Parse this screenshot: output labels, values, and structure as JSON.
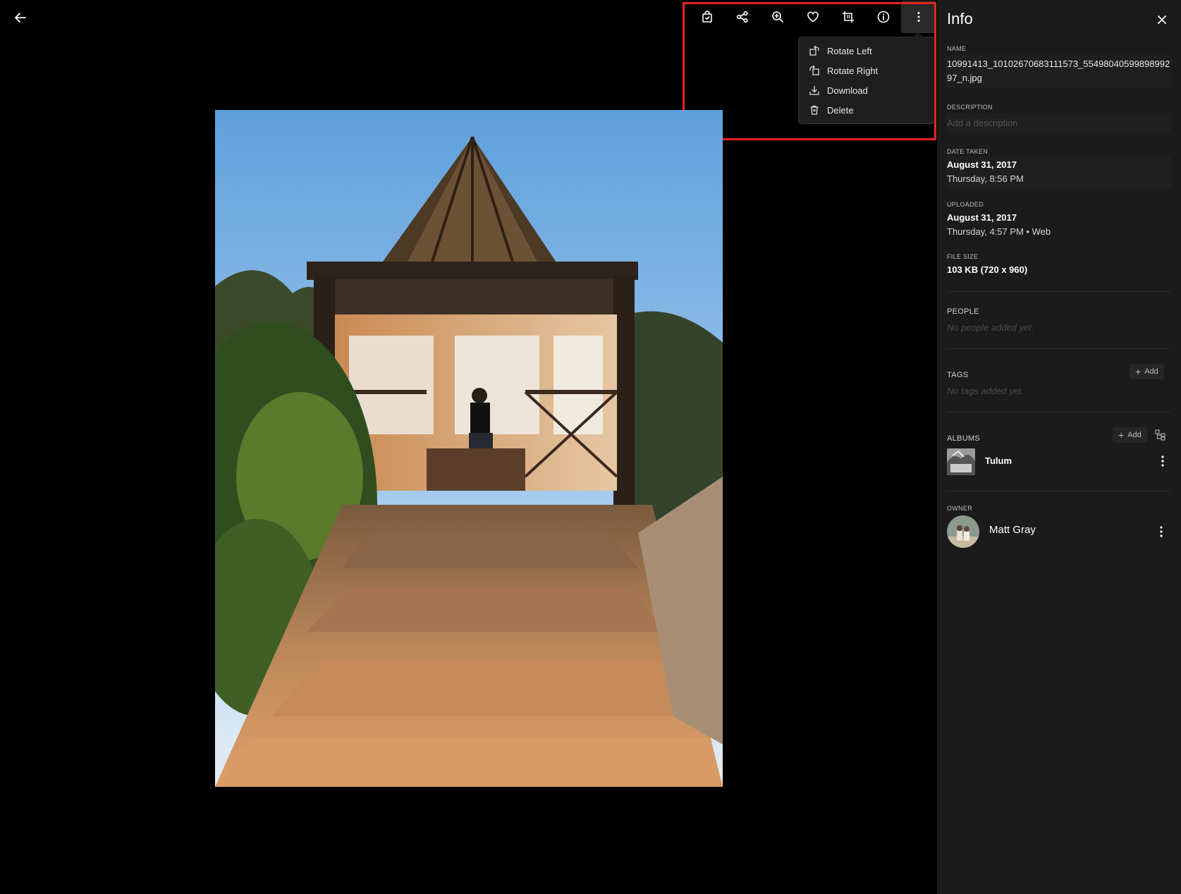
{
  "toolbar": {
    "back_icon": "arrow-left-icon",
    "buttons": [
      {
        "icon": "bag-icon"
      },
      {
        "icon": "share-icon"
      },
      {
        "icon": "zoom-in-icon"
      },
      {
        "icon": "heart-icon"
      },
      {
        "icon": "crop-icon"
      },
      {
        "icon": "info-icon"
      },
      {
        "icon": "more-vertical-icon"
      }
    ]
  },
  "menu": {
    "items": [
      {
        "label": "Rotate Left",
        "icon": "rotate-left-icon"
      },
      {
        "label": "Rotate Right",
        "icon": "rotate-right-icon"
      },
      {
        "label": "Download",
        "icon": "download-icon"
      },
      {
        "label": "Delete",
        "icon": "trash-icon"
      }
    ]
  },
  "info": {
    "title": "Info",
    "name_label": "NAME",
    "name_value": "10991413_10102670683111573_5549804059989899297_n.jpg",
    "description_label": "DESCRIPTION",
    "description_placeholder": "Add a description",
    "date_taken_label": "DATE TAKEN",
    "date_taken_date": "August 31, 2017",
    "date_taken_time": "Thursday, 8:56 PM",
    "uploaded_label": "UPLOADED",
    "uploaded_date": "August 31, 2017",
    "uploaded_time": "Thursday, 4:57 PM • Web",
    "file_size_label": "FILE SIZE",
    "file_size_value": "103 KB (720 x 960)",
    "people_label": "PEOPLE",
    "people_empty": "No people added yet.",
    "tags_label": "TAGS",
    "tags_add": "Add",
    "tags_empty": "No tags added yet.",
    "albums_label": "ALBUMS",
    "albums_add": "Add",
    "albums": [
      {
        "name": "Tulum"
      }
    ],
    "owner_label": "OWNER",
    "owner_name": "Matt Gray"
  },
  "colors": {
    "highlight": "#e5251f",
    "panel_bg": "#1b1b1b",
    "viewer_bg": "#000000"
  }
}
